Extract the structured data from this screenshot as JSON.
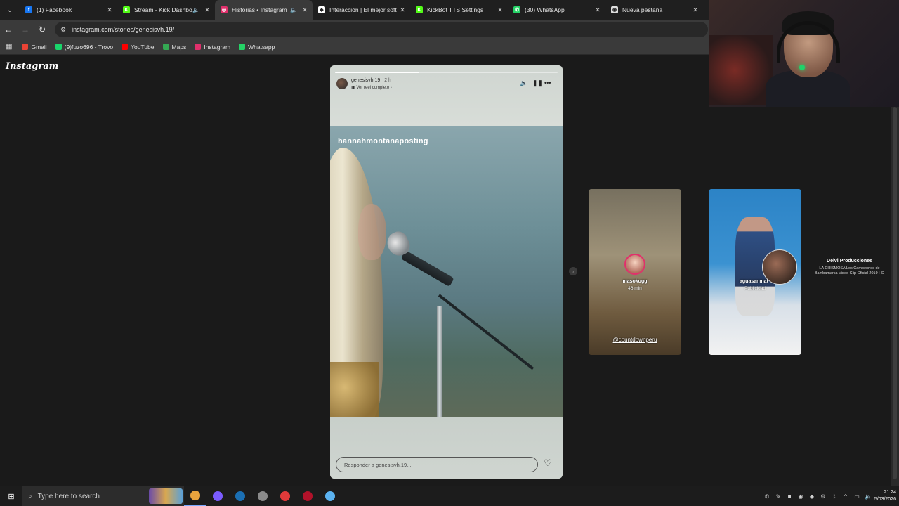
{
  "browser": {
    "tabs": [
      {
        "title": "(1) Facebook",
        "icon": "facebook-icon",
        "color": "#1877f2",
        "glyph": "f",
        "active": false,
        "audio": false
      },
      {
        "title": "Stream - Kick Dashbo",
        "icon": "kick-icon",
        "color": "#53fc18",
        "glyph": "K",
        "active": false,
        "audio": true,
        "audio_icon": "muted-speaker-icon"
      },
      {
        "title": "Historias • Instagram",
        "icon": "instagram-icon",
        "color": "#e1306c",
        "glyph": "◎",
        "active": true,
        "audio": true,
        "audio_icon": "speaker-icon"
      },
      {
        "title": "Interacción | El mejor soft",
        "icon": "diamond-icon",
        "color": "#ffffff",
        "glyph": "◆",
        "active": false,
        "audio": false
      },
      {
        "title": "KickBot TTS Settings",
        "icon": "kick-icon",
        "color": "#53fc18",
        "glyph": "K",
        "active": false,
        "audio": false
      },
      {
        "title": "(30) WhatsApp",
        "icon": "whatsapp-icon",
        "color": "#25d366",
        "glyph": "✆",
        "active": false,
        "audio": false
      },
      {
        "title": "Nueva pestaña",
        "icon": "chrome-icon",
        "color": "#dddddd",
        "glyph": "◉",
        "active": false,
        "audio": false
      }
    ],
    "url": "instagram.com/stories/genesisvh.19/",
    "bookmarks": [
      {
        "label": "Gmail",
        "color": "#ea4335"
      },
      {
        "label": "(9)fuzo696 - Trovo",
        "color": "#19d66b"
      },
      {
        "label": "YouTube",
        "color": "#ff0000"
      },
      {
        "label": "Maps",
        "color": "#34a853"
      },
      {
        "label": "Instagram",
        "color": "#e1306c"
      },
      {
        "label": "Whatsapp",
        "color": "#25d366"
      }
    ]
  },
  "page": {
    "logo": "Instagram",
    "story": {
      "username": "genesisvh.19",
      "time": "2 h",
      "subtitle": "Ver reel completo",
      "caption": "hannahmontanaposting",
      "reply_placeholder": "Responder a genesisvh.19...",
      "progress": 0.38
    },
    "previews": [
      {
        "username": "masokugg",
        "time": "46 min",
        "tag": "@countdownperu"
      },
      {
        "username": "aguasanmat",
        "label": "Publicidad"
      }
    ],
    "side": {
      "title": "Deivi Producciones",
      "description": "LA CHISMOSA Los Campeones de Bambamarca Video Clip Oficial 2019 HD"
    }
  },
  "taskbar": {
    "search_placeholder": "Type here to search",
    "time": "21:24",
    "date": "5/03/2026",
    "apps": [
      {
        "name": "chrome",
        "color": "#e8a33d"
      },
      {
        "name": "messenger",
        "color": "#7b5cff"
      },
      {
        "name": "steam",
        "color": "#1b6fb3"
      },
      {
        "name": "app-gray",
        "color": "#8a8a8a"
      },
      {
        "name": "app-red",
        "color": "#e03a3a"
      },
      {
        "name": "app-dark-red",
        "color": "#b1122a"
      },
      {
        "name": "app-blue",
        "color": "#5bb2f0"
      }
    ]
  }
}
